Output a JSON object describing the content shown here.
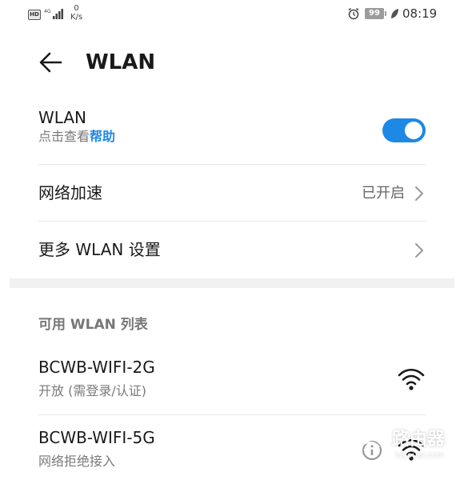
{
  "status_bar": {
    "hd_badge": "HD",
    "network_type": "4G",
    "speed_value": "0",
    "speed_unit": "K/s",
    "battery_level": "99",
    "time": "08:19"
  },
  "header": {
    "title": "WLAN",
    "back_icon": "arrow-left-icon"
  },
  "wlan_toggle": {
    "title": "WLAN",
    "subtitle_prefix": "点击查看",
    "help_link": "帮助",
    "enabled": true,
    "accent_color": "#1e88e5"
  },
  "network_boost": {
    "label": "网络加速",
    "value": "已开启"
  },
  "more_settings": {
    "label": "更多 WLAN 设置"
  },
  "available_section": {
    "title": "可用 WLAN 列表",
    "networks": [
      {
        "ssid": "BCWB-WIFI-2G",
        "status": "开放 (需登录/认证)",
        "icon": "wifi-signal-icon"
      },
      {
        "ssid": "BCWB-WIFI-5G",
        "status": "网络拒绝接入",
        "icon": "wifi-signal-icon"
      }
    ]
  },
  "watermark": {
    "label": "路由器",
    "sub": "luyouqi.com"
  }
}
